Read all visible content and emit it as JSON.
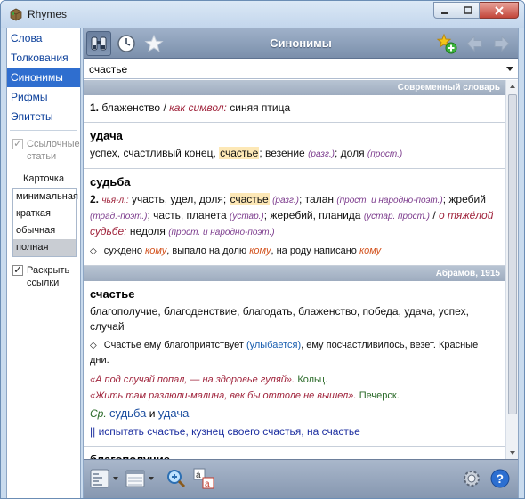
{
  "window": {
    "title": "Rhymes"
  },
  "sidebar": {
    "nav": [
      {
        "label": "Слова"
      },
      {
        "label": "Толкования"
      },
      {
        "label": "Синонимы"
      },
      {
        "label": "Рифмы"
      },
      {
        "label": "Эпитеты"
      }
    ],
    "ref_articles_label": "Ссылочные статьи",
    "card_label": "Карточка",
    "card_options": [
      "минимальная",
      "краткая",
      "обычная",
      "полная"
    ],
    "expand_links_label": "Раскрыть ссылки"
  },
  "toolbar": {
    "title": "Синонимы"
  },
  "search": {
    "value": "счастье"
  },
  "sources": {
    "modern": "Современный словарь",
    "abramov": "Абрамов, 1915"
  },
  "entry1": {
    "num": "1.",
    "text": "блаженство",
    "sep": "/",
    "label": "как символ:",
    "rest": "синяя птица"
  },
  "udacha": {
    "head": "удача",
    "a": "успех, счастливый конец,",
    "hl": "счастье",
    "b": "; везение",
    "lab1": "(разг.)",
    "c": "; доля",
    "lab2": "(прост.)"
  },
  "sudba": {
    "head": "судьба",
    "num": "2.",
    "lab0": "чья-л.:",
    "a": "участь, удел, доля;",
    "hl": "счастье",
    "lab1": "(разг.)",
    "b": "; талан",
    "lab2": "(прост. и народно-поэт.)",
    "c": "; жребий",
    "lab3": "(трад.-поэт.)",
    "d": "; часть, планета",
    "lab4": "(устар.)",
    "e": "; жеребий, планида",
    "lab5": "(устар. прост.)",
    "f": "/",
    "lab6": "о тяжёлой судьбе:",
    "g": "недоля",
    "lab7": "(прост. и народно-поэт.)",
    "phr1": "суждено",
    "phr1k": "кому",
    "phr2": ", выпало на долю",
    "phr2k": "кому",
    "phr3": ", на роду написано",
    "phr3k": "кому"
  },
  "schastie": {
    "head": "счастье",
    "text": "благополучие, благоденствие, благодать, блаженство, победа, удача, успех, случай",
    "phr": "Счастье ему благоприятствует",
    "phr_paren": "(улыбается)",
    "phr_rest": ", ему посчастливилось, везет. Красные дни.",
    "q1": "«А под случай попал, — на здоровье гуляй».",
    "q1a": "Кольц.",
    "q2": "«Жить там разлюли-малина, век бы оттоле не вышел».",
    "q2a": "Печерск.",
    "cf": "Ср.",
    "cf1": "судьба",
    "cf_and": "и",
    "cf2": "удача",
    "links": "|| испытать счастье, кузнец своего счастья, на счастье"
  },
  "blagopoluchie": {
    "head": "благополучие"
  }
}
